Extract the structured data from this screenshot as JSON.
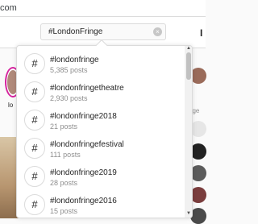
{
  "browser": {
    "url_fragment": "com"
  },
  "search": {
    "query": "#LondonFringe"
  },
  "header": {
    "edge_char": "I"
  },
  "background": {
    "story_label": "lo",
    "suggestions_fragment": "gge"
  },
  "results": [
    {
      "tag": "#londonfringe",
      "count": "5,385 posts"
    },
    {
      "tag": "#londonfringetheatre",
      "count": "2,930 posts"
    },
    {
      "tag": "#londonfringe2018",
      "count": "21 posts"
    },
    {
      "tag": "#londonfringefestival",
      "count": "111 posts"
    },
    {
      "tag": "#londonfringe2019",
      "count": "28 posts"
    },
    {
      "tag": "#londonfringe2016",
      "count": "15 posts"
    }
  ],
  "icons": {
    "hashtag": "#",
    "clear": "×",
    "scroll_up": "▲",
    "scroll_down": "▼"
  }
}
